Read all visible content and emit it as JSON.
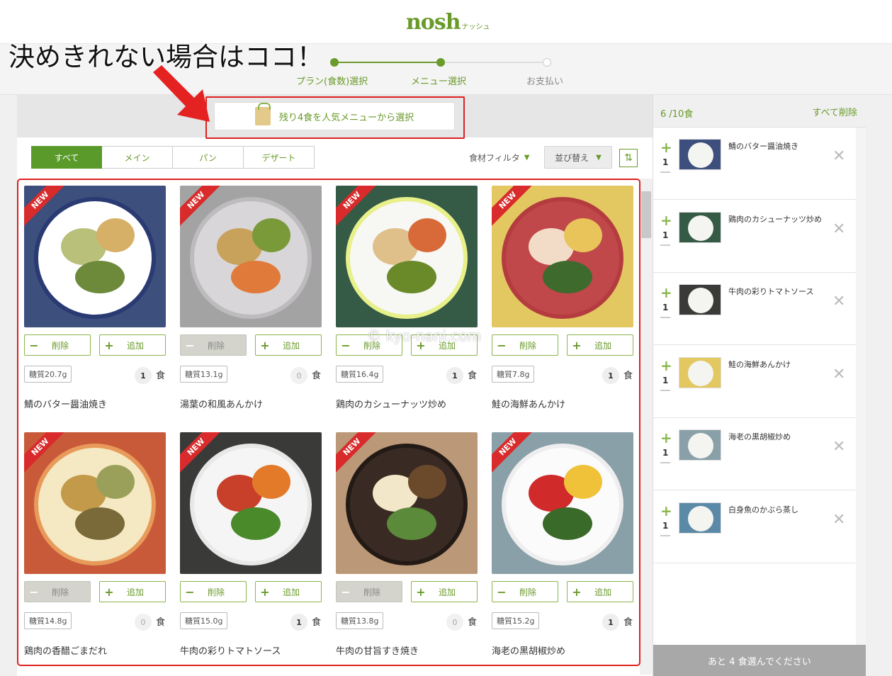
{
  "header": {
    "logo_main": "nosh",
    "logo_sub": "ナッシュ",
    "annotation": "決めきれない場合はココ！",
    "steps": [
      "プラン(食数)選択",
      "メニュー選択",
      "お支払い"
    ]
  },
  "colors": {
    "brand": "#6a9a2a",
    "accent_red": "#e02020",
    "new_badge": "#d92b2b"
  },
  "choose": {
    "label": "残り4食を人気メニューから選択",
    "icon": "bag-icon"
  },
  "tabs": [
    "すべて",
    "メイン",
    "パン",
    "デザート"
  ],
  "filter_label": "食材フィルタ",
  "sort_label": "並び替え",
  "watermark": "© kyo-nani.com",
  "buttons": {
    "remove": "削除",
    "add": "追加",
    "unit": "食"
  },
  "badge_new": "NEW",
  "menus": [
    {
      "name": "鯖のバター醤油焼き",
      "sugar": "糖質20.7g",
      "count": "1",
      "remove_disabled": false
    },
    {
      "name": "湯葉の和風あんかけ",
      "sugar": "糖質13.1g",
      "count": "0",
      "remove_disabled": true
    },
    {
      "name": "鶏肉のカシューナッツ炒め",
      "sugar": "糖質16.4g",
      "count": "1",
      "remove_disabled": false
    },
    {
      "name": "鮭の海鮮あんかけ",
      "sugar": "糖質7.8g",
      "count": "1",
      "remove_disabled": false
    },
    {
      "name": "鶏肉の香醋ごまだれ",
      "sugar": "糖質14.8g",
      "count": "0",
      "remove_disabled": true
    },
    {
      "name": "牛肉の彩りトマトソース",
      "sugar": "糖質15.0g",
      "count": "1",
      "remove_disabled": false
    },
    {
      "name": "牛肉の甘旨すき焼き",
      "sugar": "糖質13.8g",
      "count": "0",
      "remove_disabled": true
    },
    {
      "name": "海老の黒胡椒炒め",
      "sugar": "糖質15.2g",
      "count": "1",
      "remove_disabled": false
    }
  ],
  "sidebar": {
    "count": "6 /10食",
    "clear_all": "すべて削除",
    "items": [
      {
        "name": "鯖のバター醤油焼き",
        "qty": "1"
      },
      {
        "name": "鶏肉のカシューナッツ炒め",
        "qty": "1"
      },
      {
        "name": "牛肉の彩りトマトソース",
        "qty": "1"
      },
      {
        "name": "鮭の海鮮あんかけ",
        "qty": "1"
      },
      {
        "name": "海老の黒胡椒炒め",
        "qty": "1"
      },
      {
        "name": "白身魚のかぶら蒸し",
        "qty": "1"
      }
    ],
    "footer": "あと 4 食選んでください"
  }
}
